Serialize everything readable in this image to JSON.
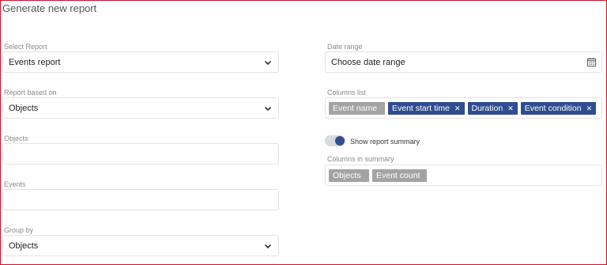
{
  "title": "Generate new report",
  "left": {
    "select_report": {
      "label": "Select Report",
      "value": "Events report"
    },
    "report_based_on": {
      "label": "Report based on",
      "value": "Objects"
    },
    "objects": {
      "label": "Objects",
      "value": ""
    },
    "events": {
      "label": "Events",
      "value": ""
    },
    "group_by": {
      "label": "Group by",
      "value": "Objects"
    }
  },
  "right": {
    "date_range": {
      "label": "Date range",
      "value": "Choose date range"
    },
    "columns_list": {
      "label": "Columns list",
      "chips": [
        {
          "text": "Event name",
          "removable": false
        },
        {
          "text": "Event start time",
          "removable": true
        },
        {
          "text": "Duration",
          "removable": true
        },
        {
          "text": "Event condition",
          "removable": true
        }
      ]
    },
    "show_summary": {
      "label": "Show report summary",
      "on": true
    },
    "columns_in_summary": {
      "label": "Columns in summary",
      "chips": [
        {
          "text": "Objects"
        },
        {
          "text": "Event count"
        }
      ]
    }
  },
  "colors": {
    "accent": "#2f4d8f",
    "chip_grey": "#a3a3a3",
    "frame": "#c8102e"
  },
  "icons": {
    "dropdown": "chevron-down-icon",
    "calendar": "calendar-icon",
    "remove": "close-icon"
  }
}
